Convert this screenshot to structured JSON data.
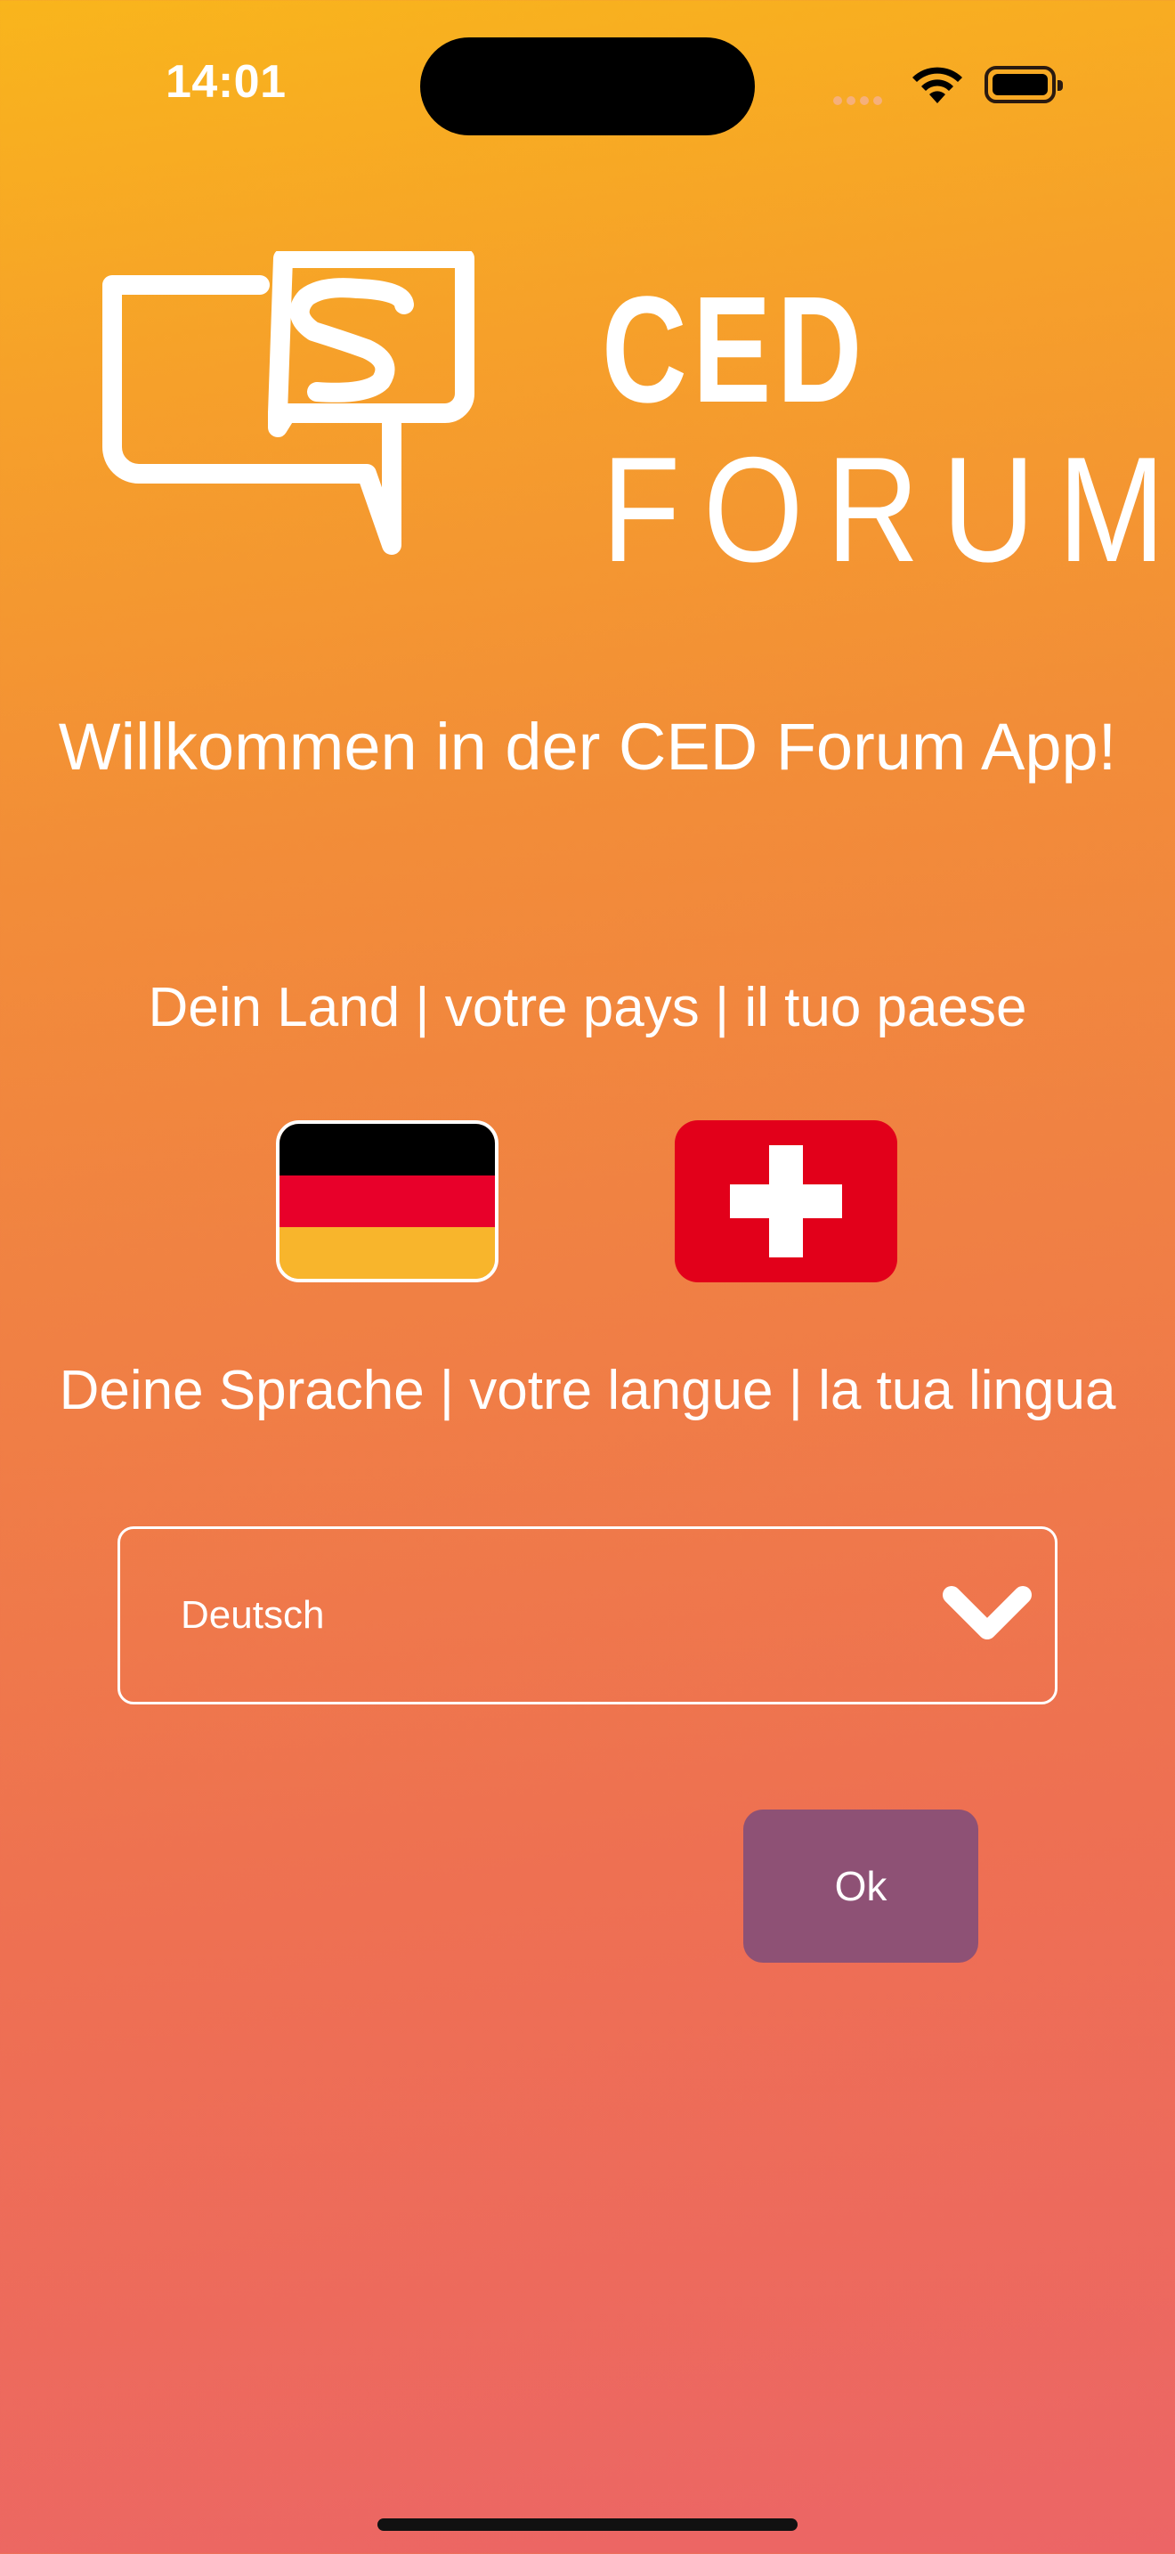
{
  "status_bar": {
    "time": "14:01",
    "icons": [
      "cellular-dots-icon",
      "wifi-icon",
      "battery-icon"
    ]
  },
  "logo": {
    "icon": "chat-bubbles-logo-icon",
    "line1": "CED",
    "line2": "FORUM"
  },
  "welcome": "Willkommen in der CED Forum App!",
  "country": {
    "label": "Dein Land | votre pays | il tuo paese",
    "options": [
      {
        "name": "germany-flag",
        "colors": [
          "#000000",
          "#e8002a",
          "#f8b52c"
        ],
        "selected": true
      },
      {
        "name": "switzerland-flag",
        "colors": [
          "#e2001a",
          "#ffffff"
        ],
        "selected": false
      }
    ]
  },
  "language": {
    "label": "Deine Sprache | votre langue | la tua lingua",
    "selected": "Deutsch",
    "icon": "chevron-down-icon"
  },
  "ok_button": {
    "label": "Ok",
    "color": "#8e5175"
  }
}
